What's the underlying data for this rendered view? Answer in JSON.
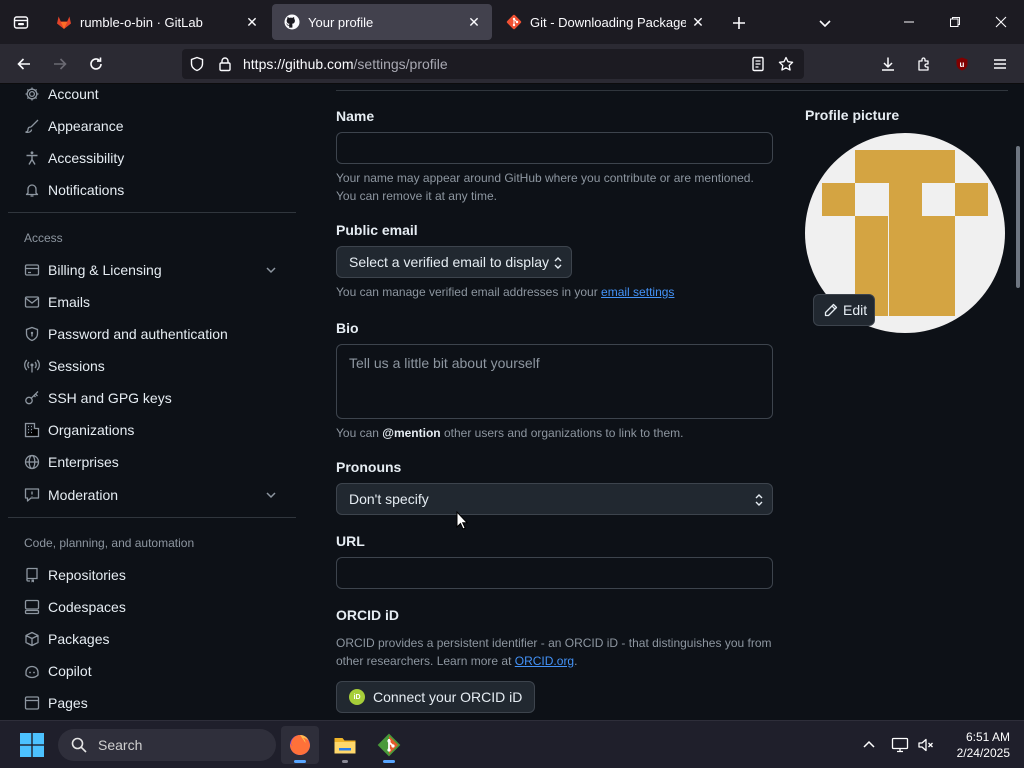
{
  "browser": {
    "tabs": [
      {
        "title": "rumble-o-bin · GitLab",
        "favicon": "gitlab-icon",
        "active": false
      },
      {
        "title": "Your profile",
        "favicon": "github-icon",
        "active": true
      },
      {
        "title": "Git - Downloading Package",
        "favicon": "git-icon",
        "active": false
      }
    ],
    "url_host": "https://github.com",
    "url_path": "/settings/profile",
    "extension_badge": "38"
  },
  "sidebar": {
    "top_items": [
      {
        "label": "Account",
        "icon": "gear-icon"
      },
      {
        "label": "Appearance",
        "icon": "paintbrush-icon"
      },
      {
        "label": "Accessibility",
        "icon": "accessibility-icon"
      },
      {
        "label": "Notifications",
        "icon": "bell-icon"
      }
    ],
    "access_heading": "Access",
    "access_items": [
      {
        "label": "Billing & Licensing",
        "icon": "credit-card-icon",
        "expandable": true
      },
      {
        "label": "Emails",
        "icon": "mail-icon"
      },
      {
        "label": "Password and authentication",
        "icon": "shield-lock-icon"
      },
      {
        "label": "Sessions",
        "icon": "broadcast-icon"
      },
      {
        "label": "SSH and GPG keys",
        "icon": "key-icon"
      },
      {
        "label": "Organizations",
        "icon": "organization-icon"
      },
      {
        "label": "Enterprises",
        "icon": "globe-icon"
      },
      {
        "label": "Moderation",
        "icon": "report-icon",
        "expandable": true
      }
    ],
    "code_heading": "Code, planning, and automation",
    "code_items": [
      {
        "label": "Repositories",
        "icon": "repo-icon"
      },
      {
        "label": "Codespaces",
        "icon": "codespaces-icon"
      },
      {
        "label": "Packages",
        "icon": "package-icon"
      },
      {
        "label": "Copilot",
        "icon": "copilot-icon"
      },
      {
        "label": "Pages",
        "icon": "browser-icon"
      }
    ]
  },
  "form": {
    "name_label": "Name",
    "name_value": "",
    "name_note": "Your name may appear around GitHub where you contribute or are mentioned. You can remove it at any time.",
    "email_label": "Public email",
    "email_select": "Select a verified email to display",
    "email_note_prefix": "You can manage verified email addresses in your ",
    "email_note_link": "email settings",
    "bio_label": "Bio",
    "bio_placeholder": "Tell us a little bit about yourself",
    "bio_note_prefix": "You can ",
    "bio_note_mention": "@mention",
    "bio_note_suffix": " other users and organizations to link to them.",
    "pronouns_label": "Pronouns",
    "pronouns_select": "Don't specify",
    "url_label": "URL",
    "url_value": "",
    "orcid_label": "ORCID iD",
    "orcid_note_prefix": "ORCID provides a persistent identifier - an ORCID iD - that distinguishes you from other researchers. Learn more at ",
    "orcid_note_link": "ORCID.org",
    "orcid_note_suffix": ".",
    "orcid_badge": "iD",
    "orcid_button": "Connect your ORCID iD"
  },
  "profile_picture": {
    "label": "Profile picture",
    "edit_label": "Edit",
    "avatar_color": "#d4a442"
  },
  "taskbar": {
    "search_label": "Search",
    "apps": [
      "firefox-icon",
      "file-explorer-icon",
      "git-gui-icon"
    ],
    "time": "6:51 AM",
    "date": "2/24/2025"
  }
}
